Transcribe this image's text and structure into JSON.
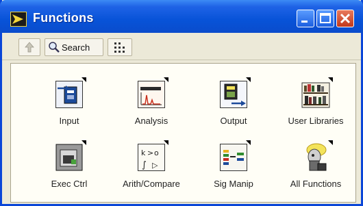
{
  "window": {
    "title": "Functions",
    "title_icon": "labview-arrow-icon",
    "controls": [
      "minimize-icon",
      "maximize-icon",
      "close-icon"
    ]
  },
  "toolbar": {
    "back_icon": "up-arrow-icon",
    "search_label": "Search",
    "search_icon": "magnifier-icon",
    "options_icon": "options-icon"
  },
  "palette": {
    "items": [
      {
        "label": "Input",
        "icon": "input-icon"
      },
      {
        "label": "Analysis",
        "icon": "analysis-icon"
      },
      {
        "label": "Output",
        "icon": "output-icon"
      },
      {
        "label": "User Libraries",
        "icon": "user-libraries-icon"
      },
      {
        "label": "Exec Ctrl",
        "icon": "exec-ctrl-icon"
      },
      {
        "label": "Arith/Compare",
        "icon": "arith-compare-icon"
      },
      {
        "label": "Sig Manip",
        "icon": "sig-manip-icon"
      },
      {
        "label": "All Functions",
        "icon": "all-functions-icon"
      }
    ]
  },
  "colors": {
    "titlebar": "#0853d8",
    "close_button": "#c2381c",
    "window_face": "#ece9d8",
    "panel": "#fffef6"
  }
}
